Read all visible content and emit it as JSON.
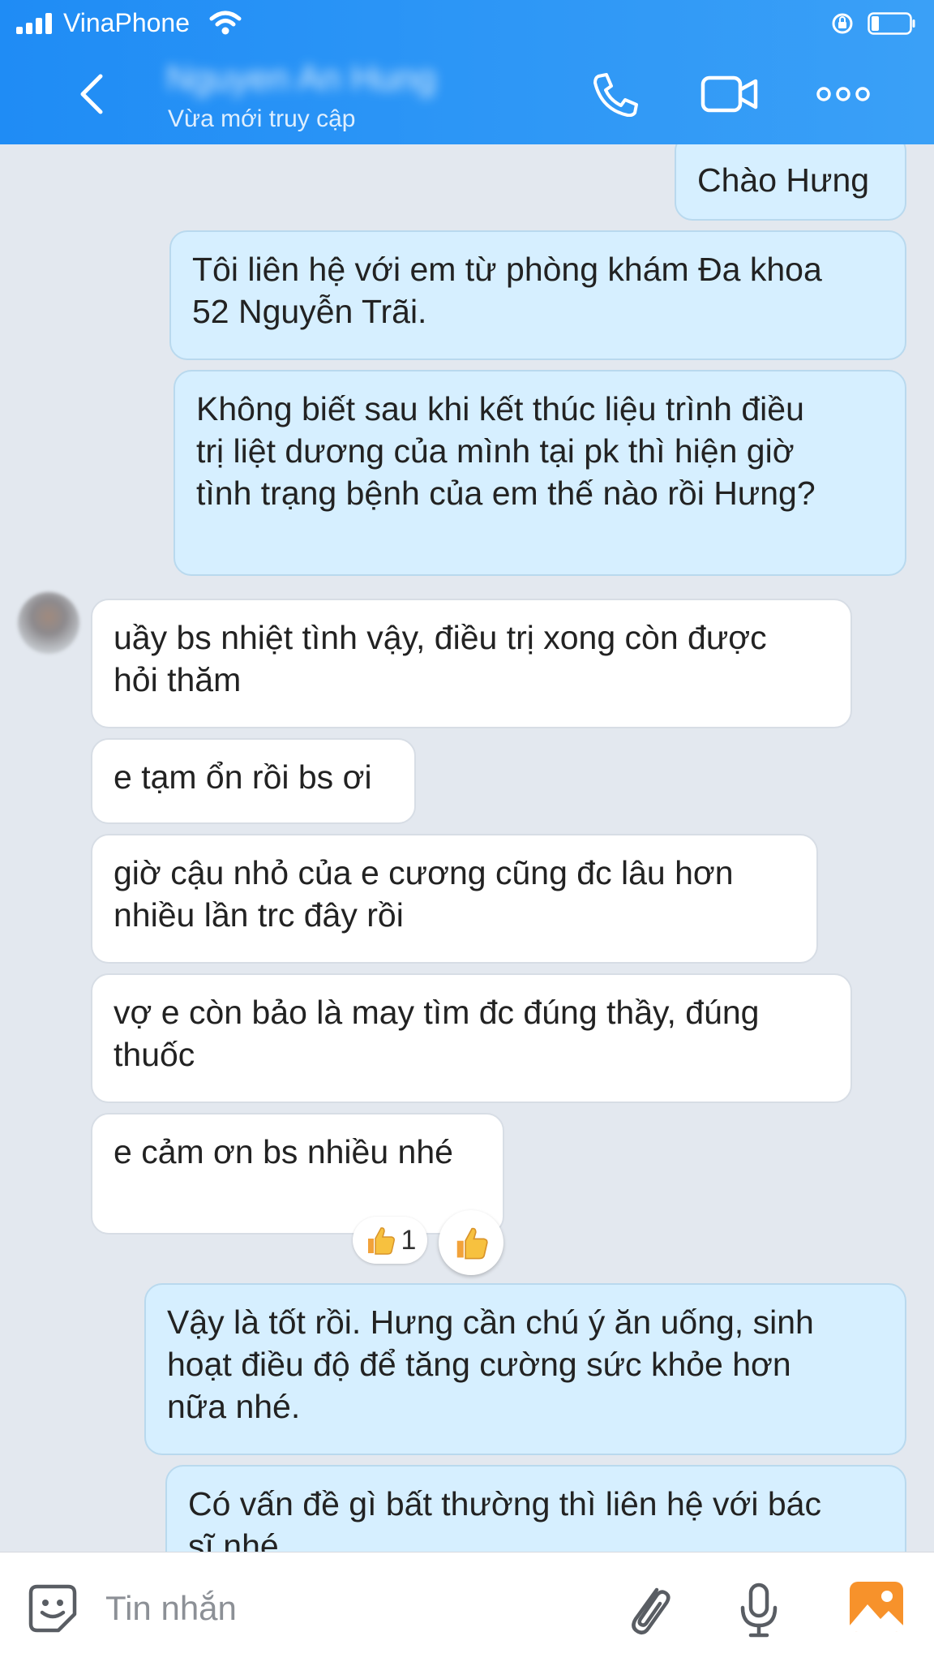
{
  "status_bar": {
    "carrier": "VinaPhone"
  },
  "header": {
    "contact_name": "Nguyen An Hung",
    "last_seen": "Vừa mới truy cập"
  },
  "messages": [
    {
      "direction": "outgoing",
      "lines": [
        "Chào Hưng"
      ]
    },
    {
      "direction": "outgoing",
      "lines": [
        "Tôi liên hệ với em từ phòng khám Đa khoa",
        "52 Nguyễn Trãi."
      ]
    },
    {
      "direction": "outgoing",
      "lines": [
        "Không biết sau khi kết thúc liệu trình điều",
        "trị liệt dương của mình tại pk thì hiện giờ",
        "tình trạng bệnh của em thế nào rồi Hưng?"
      ]
    },
    {
      "direction": "incoming",
      "lines": [
        "uầy bs nhiệt tình vậy, điều trị xong còn được",
        "hỏi thăm"
      ]
    },
    {
      "direction": "incoming",
      "lines": [
        "e tạm ổn rồi bs ơi"
      ]
    },
    {
      "direction": "incoming",
      "lines": [
        "giờ cậu nhỏ của e cương cũng đc lâu hơn",
        "nhiều lần trc đây rồi"
      ]
    },
    {
      "direction": "incoming",
      "lines": [
        "vợ e còn bảo là may tìm đc đúng thầy, đúng",
        "thuốc"
      ]
    },
    {
      "direction": "incoming",
      "lines": [
        "e cảm ơn bs nhiều nhé"
      ],
      "reaction": {
        "icon": "thumbs-up",
        "count": "1"
      }
    },
    {
      "direction": "outgoing",
      "lines": [
        "Vậy là tốt rồi. Hưng cần chú ý ăn uống, sinh",
        "hoạt điều độ để tăng cường sức khỏe hơn",
        "nữa nhé."
      ]
    },
    {
      "direction": "outgoing",
      "lines": [
        "Có vấn đề gì bất thường thì liên hệ với bác",
        "sĩ nhé"
      ]
    }
  ],
  "composer": {
    "placeholder": "Tin nhắn"
  },
  "colors": {
    "header": "#2a94f6",
    "outgoing_bubble": "#d6efff",
    "incoming_bubble": "#ffffff",
    "background": "#e3e8ef"
  }
}
